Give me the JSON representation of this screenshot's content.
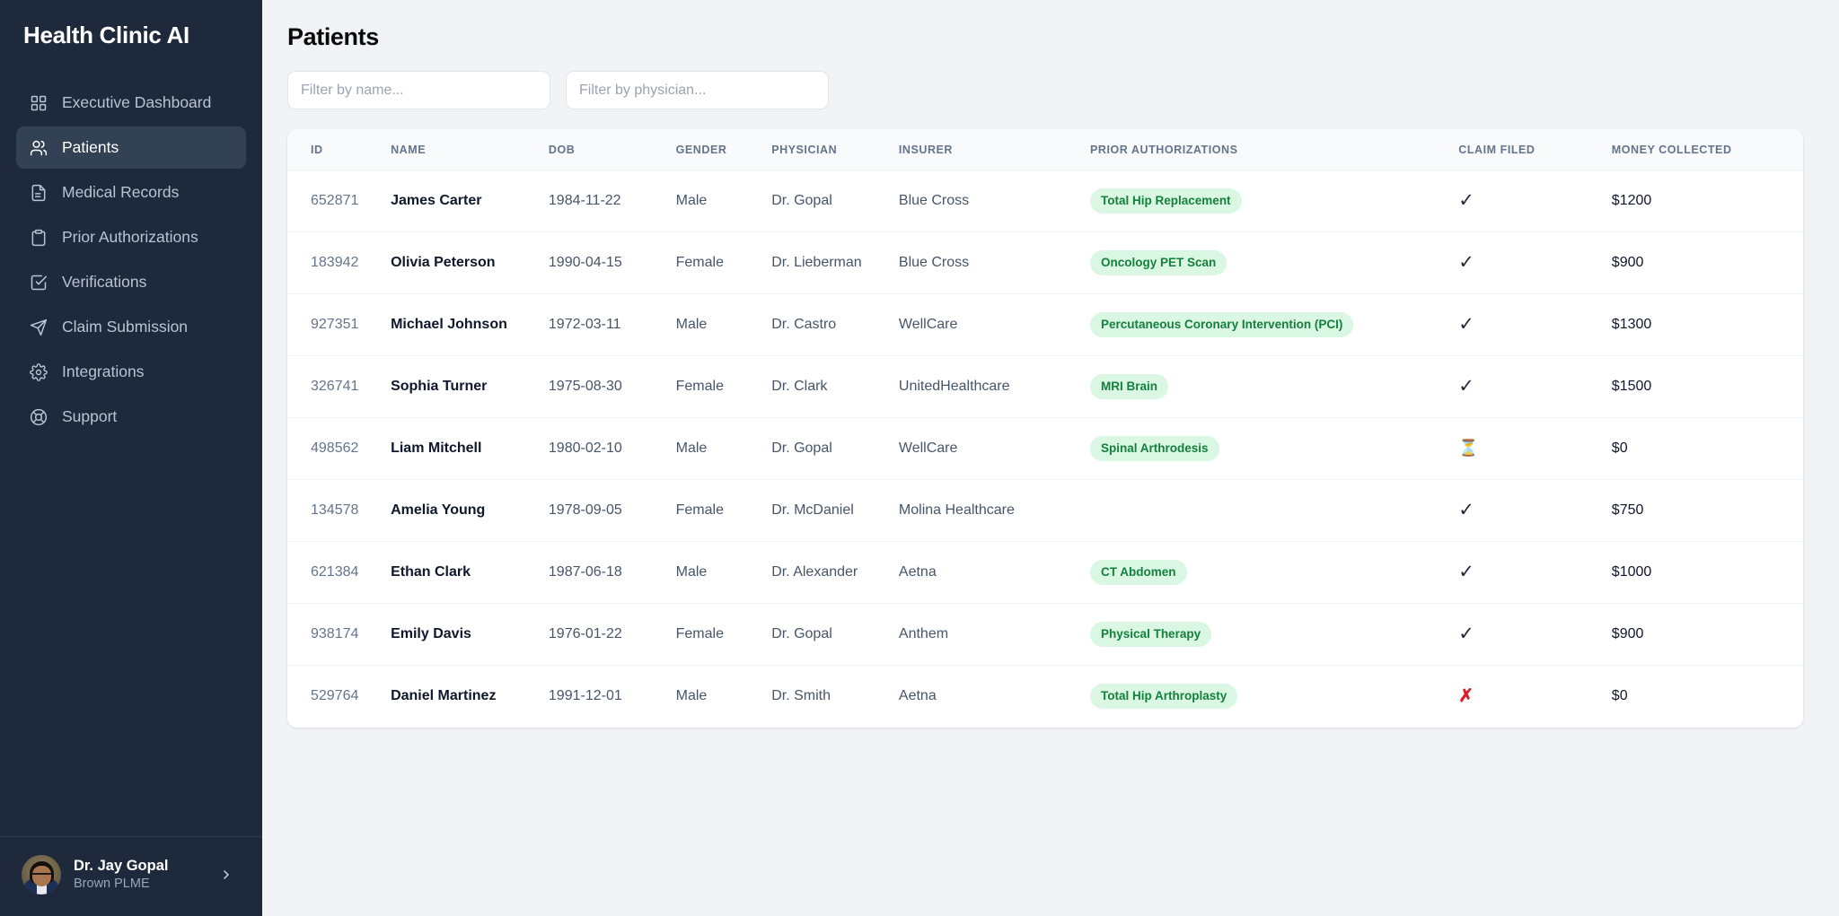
{
  "sidebar": {
    "brand": "Health Clinic AI",
    "items": [
      {
        "label": "Executive Dashboard",
        "icon": "grid-icon",
        "active": false
      },
      {
        "label": "Patients",
        "icon": "users-icon",
        "active": true
      },
      {
        "label": "Medical Records",
        "icon": "document-icon",
        "active": false
      },
      {
        "label": "Prior Authorizations",
        "icon": "clipboard-icon",
        "active": false
      },
      {
        "label": "Verifications",
        "icon": "check-square-icon",
        "active": false
      },
      {
        "label": "Claim Submission",
        "icon": "paper-plane-icon",
        "active": false
      },
      {
        "label": "Integrations",
        "icon": "gear-icon",
        "active": false
      },
      {
        "label": "Support",
        "icon": "life-buoy-icon",
        "active": false
      }
    ],
    "profile": {
      "name": "Dr. Jay Gopal",
      "org": "Brown PLME",
      "chevron": "chevron-right-icon"
    }
  },
  "main": {
    "title": "Patients",
    "filters": [
      {
        "name": "name-filter",
        "placeholder": "Filter by name...",
        "value": ""
      },
      {
        "name": "physician-filter",
        "placeholder": "Filter by physician...",
        "value": ""
      }
    ],
    "table": {
      "columns": [
        "ID",
        "NAME",
        "DOB",
        "GENDER",
        "PHYSICIAN",
        "INSURER",
        "PRIOR AUTHORIZATIONS",
        "CLAIM FILED",
        "MONEY COLLECTED"
      ],
      "rows": [
        {
          "id": "652871",
          "name": "James Carter",
          "dob": "1984-11-22",
          "gender": "Male",
          "physician": "Dr. Gopal",
          "insurer": "Blue Cross",
          "prior_auth": "Total Hip Replacement",
          "claim_filed": "✓",
          "claim_status": "yes",
          "money_collected": "$1200"
        },
        {
          "id": "183942",
          "name": "Olivia Peterson",
          "dob": "1990-04-15",
          "gender": "Female",
          "physician": "Dr. Lieberman",
          "insurer": "Blue Cross",
          "prior_auth": "Oncology PET Scan",
          "claim_filed": "✓",
          "claim_status": "yes",
          "money_collected": "$900"
        },
        {
          "id": "927351",
          "name": "Michael Johnson",
          "dob": "1972-03-11",
          "gender": "Male",
          "physician": "Dr. Castro",
          "insurer": "WellCare",
          "prior_auth": "Percutaneous Coronary Intervention (PCI)",
          "claim_filed": "✓",
          "claim_status": "yes",
          "money_collected": "$1300"
        },
        {
          "id": "326741",
          "name": "Sophia Turner",
          "dob": "1975-08-30",
          "gender": "Female",
          "physician": "Dr. Clark",
          "insurer": "UnitedHealthcare",
          "prior_auth": "MRI Brain",
          "claim_filed": "✓",
          "claim_status": "yes",
          "money_collected": "$1500"
        },
        {
          "id": "498562",
          "name": "Liam Mitchell",
          "dob": "1980-02-10",
          "gender": "Male",
          "physician": "Dr. Gopal",
          "insurer": "WellCare",
          "prior_auth": "Spinal Arthrodesis",
          "claim_filed": "⏳",
          "claim_status": "pending",
          "money_collected": "$0"
        },
        {
          "id": "134578",
          "name": "Amelia Young",
          "dob": "1978-09-05",
          "gender": "Female",
          "physician": "Dr. McDaniel",
          "insurer": "Molina Healthcare",
          "prior_auth": "",
          "claim_filed": "✓",
          "claim_status": "yes",
          "money_collected": "$750"
        },
        {
          "id": "621384",
          "name": "Ethan Clark",
          "dob": "1987-06-18",
          "gender": "Male",
          "physician": "Dr. Alexander",
          "insurer": "Aetna",
          "prior_auth": "CT Abdomen",
          "claim_filed": "✓",
          "claim_status": "yes",
          "money_collected": "$1000"
        },
        {
          "id": "938174",
          "name": "Emily Davis",
          "dob": "1976-01-22",
          "gender": "Female",
          "physician": "Dr. Gopal",
          "insurer": "Anthem",
          "prior_auth": "Physical Therapy",
          "claim_filed": "✓",
          "claim_status": "yes",
          "money_collected": "$900"
        },
        {
          "id": "529764",
          "name": "Daniel Martinez",
          "dob": "1991-12-01",
          "gender": "Male",
          "physician": "Dr. Smith",
          "insurer": "Aetna",
          "prior_auth": "Total Hip Arthroplasty",
          "claim_filed": "✗",
          "claim_status": "no",
          "money_collected": "$0"
        }
      ]
    }
  },
  "colors": {
    "sidebar_bg": "#1e293b",
    "sidebar_active": "#334155",
    "page_bg": "#f1f3f6",
    "badge_bg": "#d9f7e2",
    "badge_text": "#15803d",
    "claim_no": "#e01b24",
    "header_text": "#64748b"
  }
}
